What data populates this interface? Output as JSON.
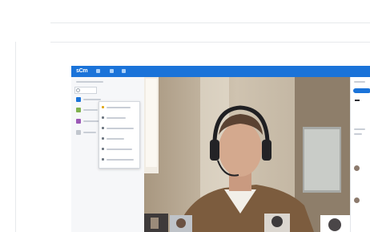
{
  "app": {
    "logo_text": "sCm",
    "accent_color": "#1a73d9"
  },
  "sidebar": {
    "items": [
      {
        "color": "#1a73d9",
        "icon": "folder-icon"
      },
      {
        "color": "#7fb24f",
        "icon": "group-icon"
      },
      {
        "color": "#9b59b6",
        "icon": "group-icon"
      },
      {
        "color": "#c2c7ce",
        "icon": "group-icon"
      }
    ]
  },
  "context_menu": {
    "items": [
      {
        "icon": "star-icon"
      },
      {
        "icon": "user-icon"
      },
      {
        "icon": "share-icon"
      },
      {
        "icon": "info-icon"
      },
      {
        "icon": "edit-icon"
      },
      {
        "icon": "trash-icon"
      }
    ]
  },
  "video_call": {
    "participant_count": 5
  }
}
